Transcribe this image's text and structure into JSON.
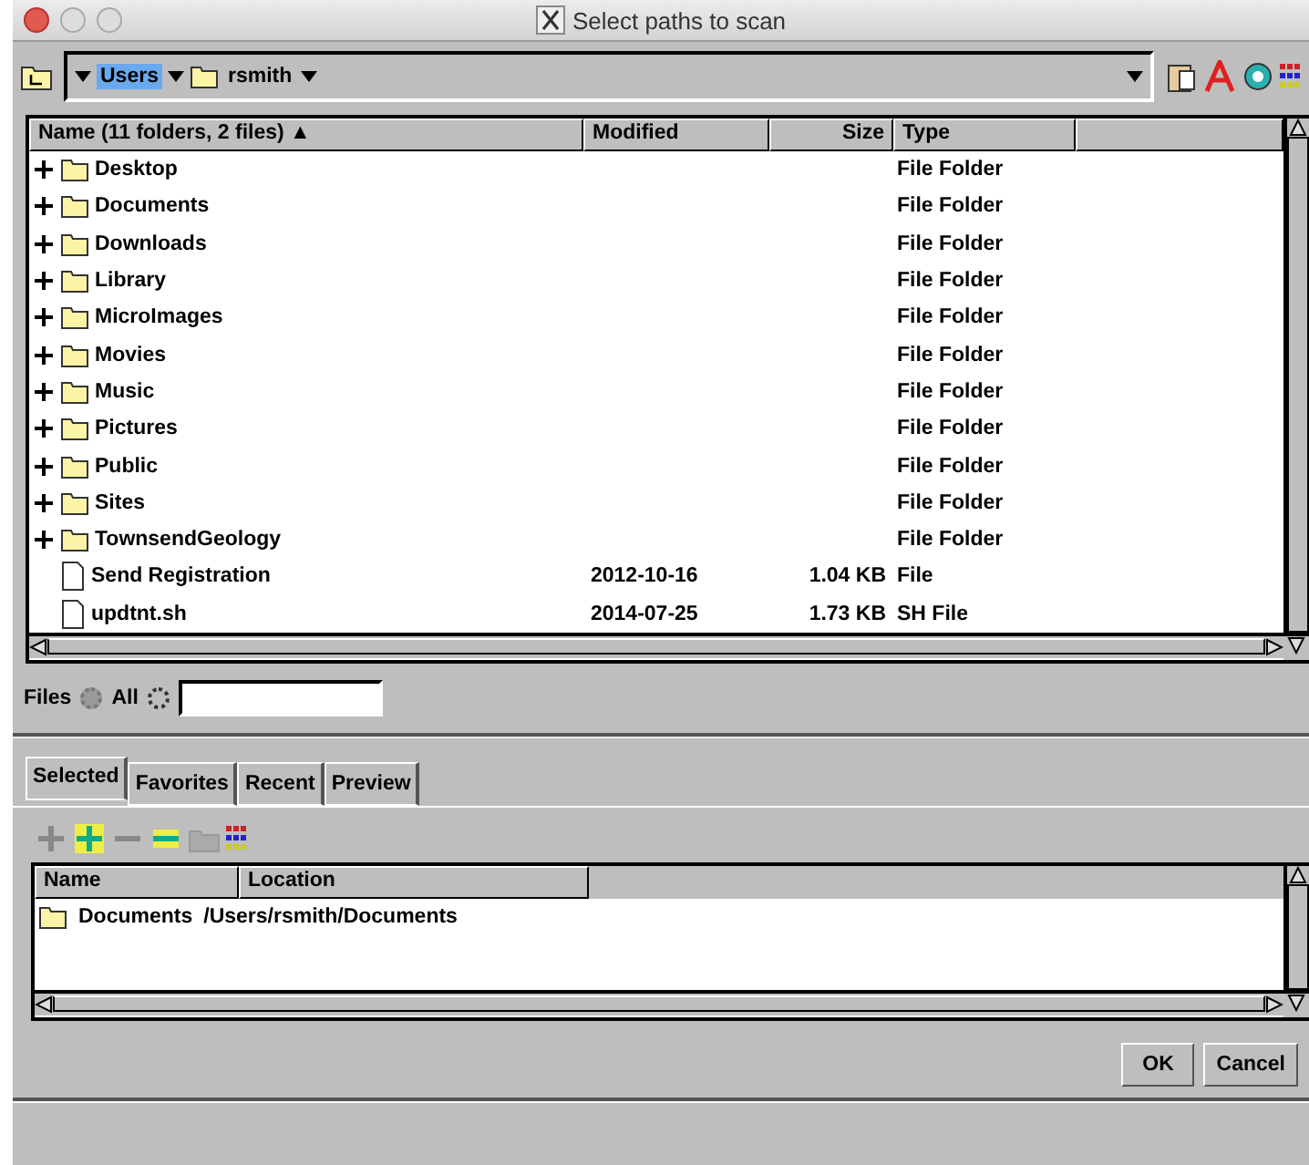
{
  "window": {
    "title": "Select paths to scan"
  },
  "path": {
    "segments": [
      {
        "label": "Users",
        "selected": true
      },
      {
        "label": "rsmith",
        "selected": false
      }
    ]
  },
  "file_list": {
    "columns": [
      "Name  (11 folders, 2 files) ▲",
      "Modified",
      "Size",
      "Type"
    ],
    "rows": [
      {
        "kind": "folder",
        "name": "Desktop",
        "modified": "",
        "size": "",
        "type": "File Folder"
      },
      {
        "kind": "folder",
        "name": "Documents",
        "modified": "",
        "size": "",
        "type": "File Folder"
      },
      {
        "kind": "folder",
        "name": "Downloads",
        "modified": "",
        "size": "",
        "type": "File Folder"
      },
      {
        "kind": "folder",
        "name": "Library",
        "modified": "",
        "size": "",
        "type": "File Folder"
      },
      {
        "kind": "folder",
        "name": "MicroImages",
        "modified": "",
        "size": "",
        "type": "File Folder"
      },
      {
        "kind": "folder",
        "name": "Movies",
        "modified": "",
        "size": "",
        "type": "File Folder"
      },
      {
        "kind": "folder",
        "name": "Music",
        "modified": "",
        "size": "",
        "type": "File Folder"
      },
      {
        "kind": "folder",
        "name": "Pictures",
        "modified": "",
        "size": "",
        "type": "File Folder"
      },
      {
        "kind": "folder",
        "name": "Public",
        "modified": "",
        "size": "",
        "type": "File Folder"
      },
      {
        "kind": "folder",
        "name": "Sites",
        "modified": "",
        "size": "",
        "type": "File Folder"
      },
      {
        "kind": "folder",
        "name": "TownsendGeology",
        "modified": "",
        "size": "",
        "type": "File Folder"
      },
      {
        "kind": "file",
        "name": "Send Registration",
        "modified": "2012-10-16",
        "size": "1.04 KB",
        "type": "File"
      },
      {
        "kind": "file",
        "name": "updtnt.sh",
        "modified": "2014-07-25",
        "size": "1.73 KB",
        "type": "SH File"
      }
    ]
  },
  "filter": {
    "label": "Files",
    "options": [
      {
        "label": "All",
        "selected": true
      },
      {
        "selected": false
      }
    ]
  },
  "tabs": [
    {
      "label": "Selected",
      "selected": true
    },
    {
      "label": "Favorites",
      "selected": false
    },
    {
      "label": "Recent",
      "selected": false
    },
    {
      "label": "Preview",
      "selected": false
    }
  ],
  "selected_list": {
    "columns": [
      "Name",
      "Location"
    ],
    "rows": [
      {
        "name": "Documents",
        "location": "/Users/rsmith/Documents"
      }
    ]
  },
  "buttons": [
    "OK",
    "Cancel"
  ]
}
